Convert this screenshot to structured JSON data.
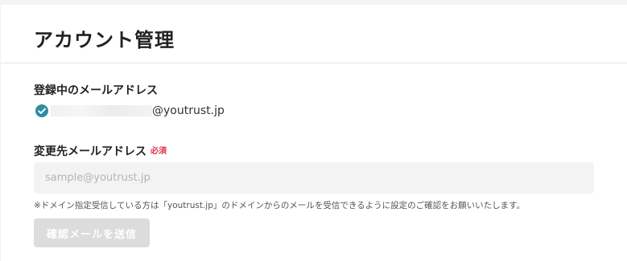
{
  "header": {
    "title": "アカウント管理"
  },
  "current_email": {
    "label": "登録中のメールアドレス",
    "status_icon": "check-circle-icon",
    "status_color": "#2b8ea3",
    "domain": "@youtrust.jp"
  },
  "new_email": {
    "label": "変更先メールアドレス",
    "required_badge": "必須",
    "required_color": "#e0334a",
    "placeholder": "sample@youtrust.jp",
    "value": "",
    "note": "※ドメイン指定受信している方は「youtrust.jp」のドメインからのメールを受信できるように設定のご確認をお願いいたします。"
  },
  "actions": {
    "submit_label": "確認メールを送信",
    "submit_enabled": false
  }
}
